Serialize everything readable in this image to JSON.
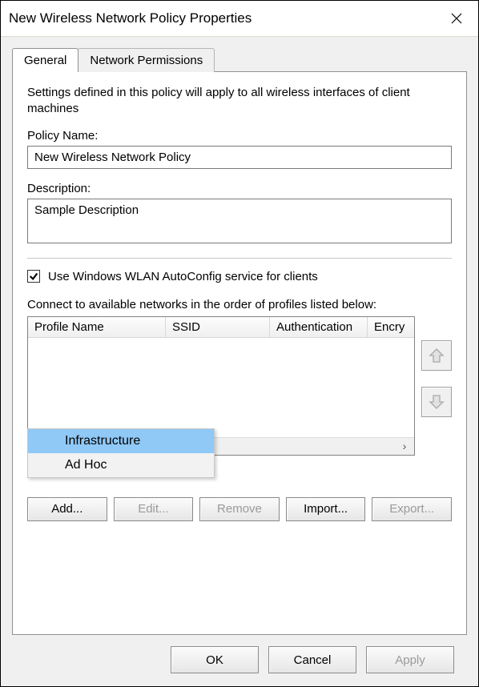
{
  "window": {
    "title": "New Wireless Network Policy Properties"
  },
  "tabs": {
    "general": "General",
    "permissions": "Network Permissions"
  },
  "general": {
    "intro": "Settings defined in this policy will apply to all wireless interfaces of client machines",
    "policy_name_label": "Policy Name:",
    "policy_name_value": "New Wireless Network Policy",
    "description_label": "Description:",
    "description_value": "Sample Description",
    "autoconfig_label": "Use Windows WLAN AutoConfig service for clients",
    "autoconfig_checked": true,
    "connect_label": "Connect to available networks in the order of profiles listed below:",
    "columns": {
      "profile": "Profile Name",
      "ssid": "SSID",
      "auth": "Authentication",
      "encr": "Encry"
    },
    "add_menu": {
      "infrastructure": "Infrastructure",
      "adhoc": "Ad Hoc"
    },
    "buttons": {
      "add": "Add...",
      "edit": "Edit...",
      "remove": "Remove",
      "import": "Import...",
      "export": "Export..."
    }
  },
  "footer": {
    "ok": "OK",
    "cancel": "Cancel",
    "apply": "Apply"
  }
}
